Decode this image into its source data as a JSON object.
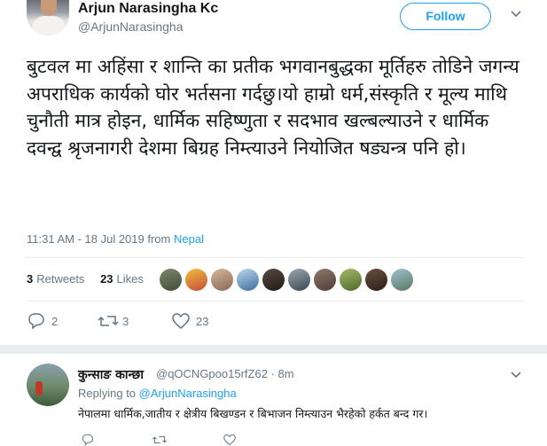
{
  "tweet": {
    "author_name": "Arjun Narasingha Kc",
    "author_handle": "@ArjunNarasingha",
    "follow_label": "Follow",
    "text": "बुटवल मा अहिंसा र शान्ति का प्रतीक भगवानबुद्धका मूर्तिहरु तोडिने जगन्य अपराधिक कार्यको घोर भर्तसना गर्दछु।यो हाम्रो धर्म,संस्कृति र मूल्य माथि चुनौती मात्र होइन, धार्मिक सहिष्णुता र सदभाव खल्बल्याउने र धार्मिक दवन्द्व श्रृजनागरी देशमा बिग्रह निम्त्याउने नियोजित षड्यन्त्र पनि हो।",
    "timestamp": "11:31 AM - 18 Jul 2019 from",
    "location": "Nepal",
    "retweets_count": "3",
    "retweets_label": "Retweets",
    "likes_count": "23",
    "likes_label": "Likes",
    "reply_count": "2",
    "retweet_action_count": "3",
    "like_action_count": "23"
  },
  "reply": {
    "author_name": "कुन्साङ कान्छा",
    "author_handle": "@qOCNGpoo15rfZ62",
    "time": "· 8m",
    "replying_label": "Replying to",
    "replying_to": "@ArjunNarasingha",
    "text": "नेपालमा धार्मिक,जातीय र क्षेत्रीय बिखण्डन र बिभाजन निम्त्याउन भैरहेको हर्कत बन्द गर।"
  },
  "colors": {
    "accent": "#1da1f2",
    "muted": "#657786",
    "text": "#14171a",
    "divider": "#e6ecf0"
  },
  "icons": [
    "reply-icon",
    "retweet-icon",
    "heart-icon",
    "chevron-down-icon"
  ]
}
